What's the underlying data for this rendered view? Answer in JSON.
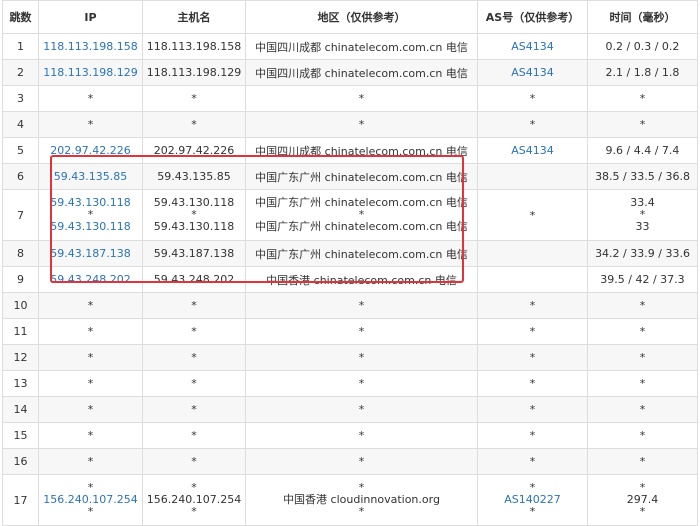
{
  "headers": {
    "hop": "跳数",
    "ip": "IP",
    "host": "主机名",
    "region": "地区（仅供参考）",
    "as": "AS号（仅供参考）",
    "time": "时间（毫秒）"
  },
  "rows": [
    {
      "hop": "1",
      "ip": [
        "118.113.198.158"
      ],
      "host": [
        "118.113.198.158"
      ],
      "region": [
        "中国四川成都 chinatelecom.com.cn 电信"
      ],
      "as": [
        "AS4134"
      ],
      "time": [
        "0.2 / 0.3 / 0.2"
      ]
    },
    {
      "hop": "2",
      "ip": [
        "118.113.198.129"
      ],
      "host": [
        "118.113.198.129"
      ],
      "region": [
        "中国四川成都 chinatelecom.com.cn 电信"
      ],
      "as": [
        "AS4134"
      ],
      "time": [
        "2.1 / 1.8 / 1.8"
      ]
    },
    {
      "hop": "3",
      "ip": [
        "*"
      ],
      "host": [
        "*"
      ],
      "region": [
        "*"
      ],
      "as": [
        "*"
      ],
      "time": [
        "*"
      ]
    },
    {
      "hop": "4",
      "ip": [
        "*"
      ],
      "host": [
        "*"
      ],
      "region": [
        "*"
      ],
      "as": [
        "*"
      ],
      "time": [
        "*"
      ]
    },
    {
      "hop": "5",
      "ip": [
        "202.97.42.226"
      ],
      "host": [
        "202.97.42.226"
      ],
      "region": [
        "中国四川成都 chinatelecom.com.cn 电信"
      ],
      "as": [
        "AS4134"
      ],
      "time": [
        "9.6 / 4.4 / 7.4"
      ]
    },
    {
      "hop": "6",
      "ip": [
        "59.43.135.85"
      ],
      "host": [
        "59.43.135.85"
      ],
      "region": [
        "中国广东广州 chinatelecom.com.cn 电信"
      ],
      "as": [
        ""
      ],
      "time": [
        "38.5 / 33.5 / 36.8"
      ]
    },
    {
      "hop": "7",
      "ip": [
        "59.43.130.118",
        "*",
        "59.43.130.118"
      ],
      "host": [
        "59.43.130.118",
        "*",
        "59.43.130.118"
      ],
      "region": [
        "中国广东广州 chinatelecom.com.cn 电信",
        "*",
        "中国广东广州 chinatelecom.com.cn 电信"
      ],
      "as": [
        "*"
      ],
      "time": [
        "33.4",
        "*",
        "33"
      ]
    },
    {
      "hop": "8",
      "ip": [
        "59.43.187.138"
      ],
      "host": [
        "59.43.187.138"
      ],
      "region": [
        "中国广东广州 chinatelecom.com.cn 电信"
      ],
      "as": [
        ""
      ],
      "time": [
        "34.2 / 33.9 / 33.6"
      ]
    },
    {
      "hop": "9",
      "ip": [
        "59.43.248.202"
      ],
      "host": [
        "59.43.248.202"
      ],
      "region": [
        "中国香港 chinatelecom.com.cn 电信"
      ],
      "as": [
        ""
      ],
      "time": [
        "39.5 / 42 / 37.3"
      ]
    },
    {
      "hop": "10",
      "ip": [
        "*"
      ],
      "host": [
        "*"
      ],
      "region": [
        "*"
      ],
      "as": [
        "*"
      ],
      "time": [
        "*"
      ]
    },
    {
      "hop": "11",
      "ip": [
        "*"
      ],
      "host": [
        "*"
      ],
      "region": [
        "*"
      ],
      "as": [
        "*"
      ],
      "time": [
        "*"
      ]
    },
    {
      "hop": "12",
      "ip": [
        "*"
      ],
      "host": [
        "*"
      ],
      "region": [
        "*"
      ],
      "as": [
        "*"
      ],
      "time": [
        "*"
      ]
    },
    {
      "hop": "13",
      "ip": [
        "*"
      ],
      "host": [
        "*"
      ],
      "region": [
        "*"
      ],
      "as": [
        "*"
      ],
      "time": [
        "*"
      ]
    },
    {
      "hop": "14",
      "ip": [
        "*"
      ],
      "host": [
        "*"
      ],
      "region": [
        "*"
      ],
      "as": [
        "*"
      ],
      "time": [
        "*"
      ]
    },
    {
      "hop": "15",
      "ip": [
        "*"
      ],
      "host": [
        "*"
      ],
      "region": [
        "*"
      ],
      "as": [
        "*"
      ],
      "time": [
        "*"
      ]
    },
    {
      "hop": "16",
      "ip": [
        "*"
      ],
      "host": [
        "*"
      ],
      "region": [
        "*"
      ],
      "as": [
        "*"
      ],
      "time": [
        "*"
      ]
    },
    {
      "hop": "17",
      "ip": [
        "*",
        "156.240.107.254",
        "*"
      ],
      "host": [
        "*",
        "156.240.107.254",
        "*"
      ],
      "region": [
        "*",
        "中国香港 cloudinnovation.org",
        "*"
      ],
      "as": [
        "*",
        "AS140227",
        "*"
      ],
      "time": [
        "*",
        "297.4",
        "*"
      ]
    }
  ],
  "colors": {
    "link": "#2a73b8",
    "border": "#dddddd",
    "stripe": "#f7f7f7",
    "highlight": "#e0343a"
  }
}
